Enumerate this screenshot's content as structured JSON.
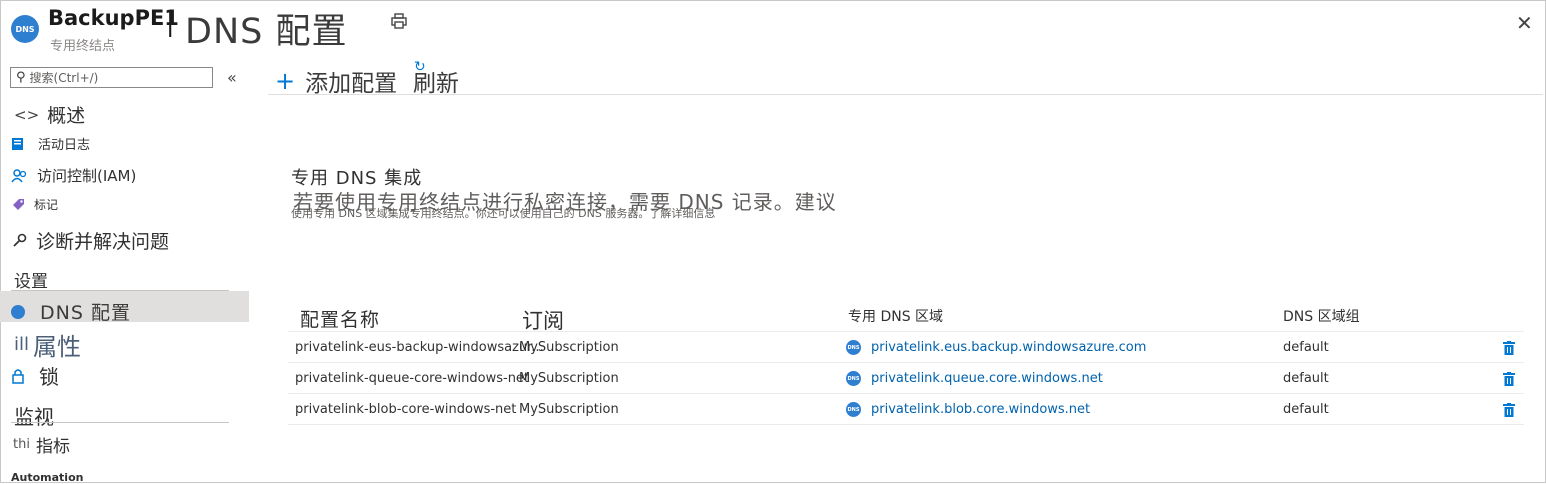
{
  "header": {
    "resource_icon_text": "DNS",
    "resource_name": "BackupPE1",
    "separator": "|",
    "page_title": "DNS 配置",
    "resource_type": "专用终结点",
    "print_icon": "print-icon",
    "close_label": "✕"
  },
  "sidebar": {
    "search_placeholder": "搜索(Ctrl+/)",
    "collapse_label": "«",
    "items": [
      {
        "label": "概述",
        "icon": "<>"
      },
      {
        "label": "活动日志",
        "icon": "activity-log-icon"
      },
      {
        "label": "访问控制(IAM)",
        "icon": "iam-icon"
      },
      {
        "label": "标记",
        "icon": "tag-icon"
      },
      {
        "label": "诊断并解决问题",
        "icon": "wrench-icon"
      }
    ],
    "settings_header": "设置",
    "settings_items": [
      {
        "label": "DNS 配置",
        "icon": "dns-icon"
      },
      {
        "label": "属性",
        "icon": "ill"
      },
      {
        "label": "锁",
        "icon": "lock-icon"
      }
    ],
    "monitor_header": "监视",
    "monitor_items": [
      {
        "label": "指标",
        "icon": "thi"
      }
    ],
    "automation_header": "Automation"
  },
  "commands": {
    "add_icon": "+",
    "add_label": "添加配置",
    "refresh_label": "刷新"
  },
  "integration": {
    "title": "专用 DNS 集成",
    "description": "若要使用专用终结点进行私密连接，需要 DNS 记录。建议",
    "subtext": "使用专用 DNS 区域集成专用终结点。你还可以使用自己的 DNS 服务器。了解详细信息"
  },
  "table": {
    "headers": [
      "配置名称",
      "订阅",
      "专用 DNS 区域",
      "DNS 区域组"
    ],
    "rows": [
      {
        "name": "privatelink-eus-backup-windowsazur...",
        "subscription": "MySubscription",
        "zone": "privatelink.eus.backup.windowsazure.com",
        "group": "default"
      },
      {
        "name": "privatelink-queue-core-windows-net",
        "subscription": "MySubscription",
        "zone": "privatelink.queue.core.windows.net",
        "group": "default"
      },
      {
        "name": "privatelink-blob-core-windows-net",
        "subscription": "MySubscription",
        "zone": "privatelink.blob.core.windows.net",
        "group": "default"
      }
    ]
  },
  "colors": {
    "accent": "#0078d4",
    "link": "#0062ad",
    "selected_bg": "#e1dfdd"
  }
}
